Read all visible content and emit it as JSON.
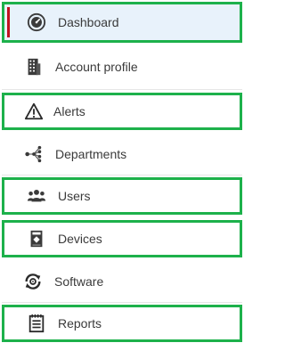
{
  "sidebar": {
    "items": [
      {
        "label": "Dashboard",
        "icon": "dashboard-gauge-icon",
        "active": true,
        "highlighted": true
      },
      {
        "label": "Account profile",
        "icon": "building-icon",
        "active": false,
        "highlighted": false
      },
      {
        "label": "Alerts",
        "icon": "warning-triangle-icon",
        "active": false,
        "highlighted": true
      },
      {
        "label": "Departments",
        "icon": "hierarchy-icon",
        "active": false,
        "highlighted": false
      },
      {
        "label": "Users",
        "icon": "users-group-icon",
        "active": false,
        "highlighted": true
      },
      {
        "label": "Devices",
        "icon": "device-icon",
        "active": false,
        "highlighted": true
      },
      {
        "label": "Software",
        "icon": "software-sync-icon",
        "active": false,
        "highlighted": false
      },
      {
        "label": "Reports",
        "icon": "report-clipboard-icon",
        "active": false,
        "highlighted": true
      }
    ]
  },
  "colors": {
    "highlight_border": "#1db14b",
    "active_marker": "#c0121f",
    "active_background": "#e8f2fb",
    "text": "#3a3a3a"
  }
}
